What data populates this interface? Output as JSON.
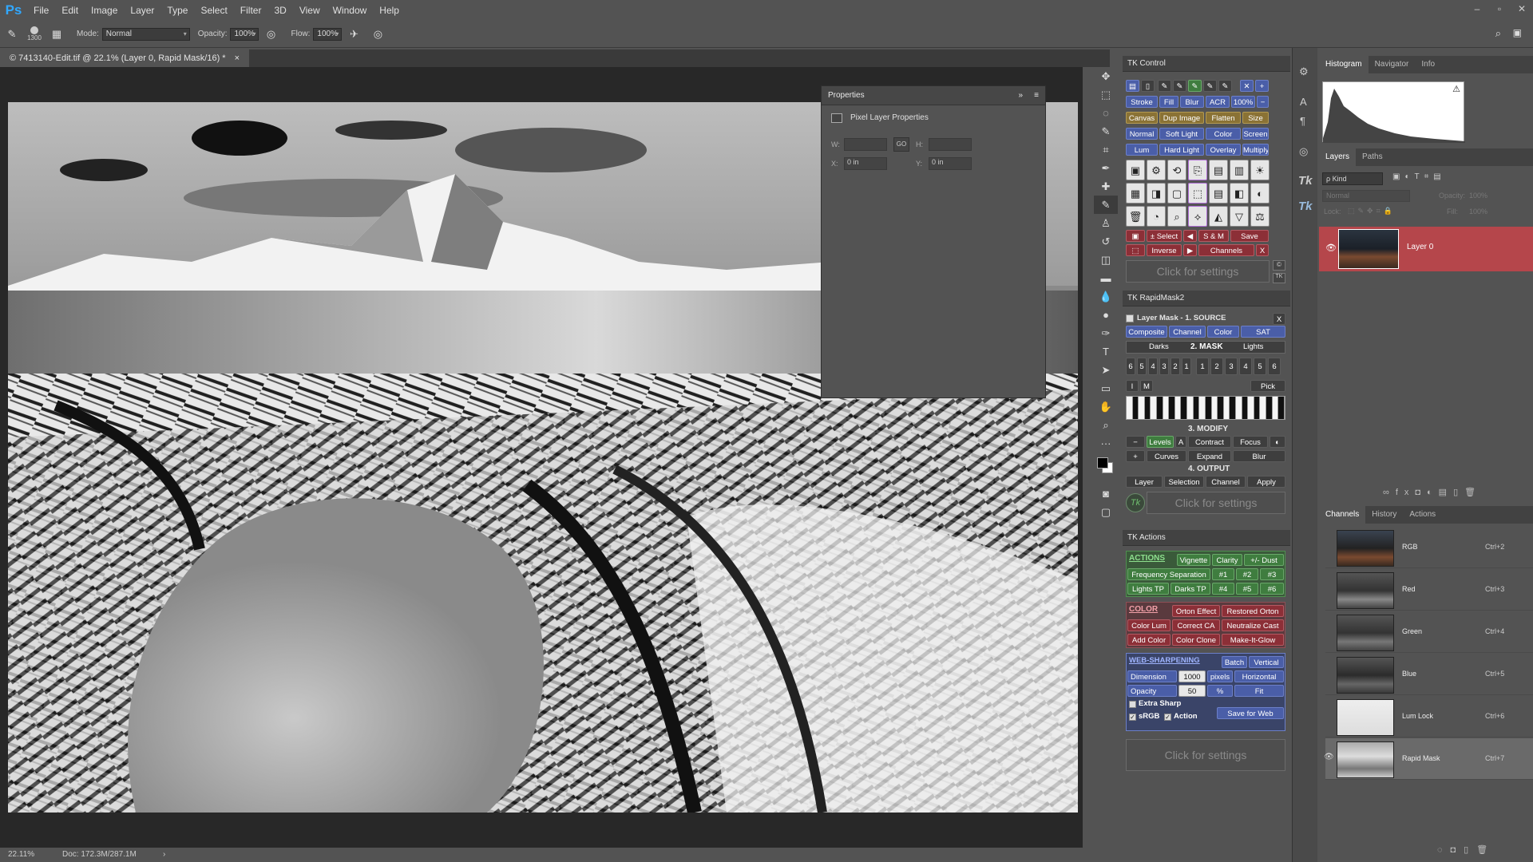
{
  "app": {
    "logo": "Ps"
  },
  "menu": [
    "File",
    "Edit",
    "Image",
    "Layer",
    "Type",
    "Select",
    "Filter",
    "3D",
    "View",
    "Window",
    "Help"
  ],
  "window_controls": [
    "–",
    "▫",
    "✕"
  ],
  "options": {
    "brush_size": "1300",
    "mode_label": "Mode:",
    "mode": "Normal",
    "opacity_label": "Opacity:",
    "opacity": "100%",
    "flow_label": "Flow:",
    "flow": "100%"
  },
  "document": {
    "tab": "© 7413140-Edit.tif @ 22.1% (Layer 0, Rapid Mask/16) *",
    "close": "×"
  },
  "status": {
    "zoom": "22.11%",
    "doc": "Doc: 172.3M/287.1M",
    "arrow": "›"
  },
  "properties": {
    "title": "Properties",
    "subtitle": "Pixel Layer Properties",
    "w_label": "W:",
    "h_label": "H:",
    "x_label": "X:",
    "y_label": "Y:",
    "x": "0 in",
    "y": "0 in",
    "link": "GO"
  },
  "tk_control": {
    "title": "TK Control",
    "row2": [
      "Stroke",
      "Fill",
      "Blur",
      "ACR",
      "100%"
    ],
    "row3": [
      "Canvas",
      "Dup Image",
      "Flatten",
      "Size"
    ],
    "row4": [
      "Normal",
      "Soft Light",
      "Color",
      "Screen"
    ],
    "row5": [
      "Lum",
      "Hard Light",
      "Overlay",
      "Multiply"
    ],
    "sel": [
      "± Select",
      "S & M",
      "Save"
    ],
    "inv": [
      "Inverse",
      "Channels",
      "X"
    ],
    "settings": "Click for settings",
    "tk": "TK"
  },
  "rapid_mask": {
    "title": "TK RapidMask2",
    "source_head": "Layer Mask - 1. SOURCE",
    "close": "X",
    "source": [
      "Composite",
      "Channel",
      "Color",
      "SAT"
    ],
    "mask_left": "Darks",
    "mask_head": "2. MASK",
    "mask_right": "Lights",
    "nums_left": [
      "6",
      "5",
      "4",
      "3",
      "2",
      "1"
    ],
    "nums_right": [
      "1",
      "2",
      "3",
      "4",
      "5",
      "6"
    ],
    "im": [
      "I",
      "M"
    ],
    "pick": "Pick",
    "modify_head": "3. MODIFY",
    "modify_r1": [
      "Levels",
      "A",
      "Contract",
      "Focus"
    ],
    "modify_r2": [
      "Curves",
      "Expand",
      "Blur"
    ],
    "output_head": "4. OUTPUT",
    "output": [
      "Layer",
      "Selection",
      "Channel",
      "Apply"
    ],
    "settings": "Click for settings"
  },
  "tk_actions": {
    "title": "TK Actions",
    "actions_head": "ACTIONS",
    "a1": [
      "Vignette",
      "Clarity",
      "+/- Dust"
    ],
    "a2": [
      "Frequency Separation",
      "#1",
      "#2",
      "#3"
    ],
    "a3": [
      "Lights TP",
      "Darks TP",
      "#4",
      "#5",
      "#6"
    ],
    "color_head": "COLOR",
    "c1": [
      "Orton Effect",
      "Restored Orton"
    ],
    "c2": [
      "Color Lum",
      "Correct CA",
      "Neutralize Cast"
    ],
    "c3": [
      "Add Color",
      "Color Clone",
      "Make-It-Glow"
    ],
    "web_head": "WEB-SHARPENING",
    "w1": [
      "Batch",
      "Vertical"
    ],
    "dimension_label": "Dimension",
    "dimension": "1000",
    "pixels": "pixels",
    "horizontal": "Horizontal",
    "opacity_label": "Opacity",
    "opacity": "50",
    "percent": "%",
    "fit": "Fit",
    "extra_sharp": "Extra Sharp",
    "srgb": "sRGB",
    "action": "Action",
    "save_web": "Save for Web",
    "settings": "Click for settings"
  },
  "right_dock": {
    "histogram_tabs": [
      "Histogram",
      "Navigator",
      "Info"
    ],
    "layers_tabs": [
      "Layers",
      "Paths"
    ],
    "kind": "ρ Kind",
    "blend": "Normal",
    "opacity_label": "Opacity:",
    "opacity": "100%",
    "lock_label": "Lock:",
    "fill_label": "Fill:",
    "fill": "100%",
    "layer_name": "Layer 0",
    "channels_tabs": [
      "Channels",
      "History",
      "Actions"
    ],
    "channels": [
      {
        "name": "RGB",
        "key": "Ctrl+2"
      },
      {
        "name": "Red",
        "key": "Ctrl+3"
      },
      {
        "name": "Green",
        "key": "Ctrl+4"
      },
      {
        "name": "Blue",
        "key": "Ctrl+5"
      },
      {
        "name": "Lum Lock",
        "key": "Ctrl+6"
      },
      {
        "name": "Rapid Mask",
        "key": "Ctrl+7"
      }
    ]
  },
  "colors": {
    "accent": "#31a8ff",
    "selected_layer": "#b5464b",
    "tk_blue": "#4a5ea8",
    "tk_gold": "#8a7235",
    "tk_green": "#3f7d3f",
    "tk_red": "#8c2f37"
  }
}
